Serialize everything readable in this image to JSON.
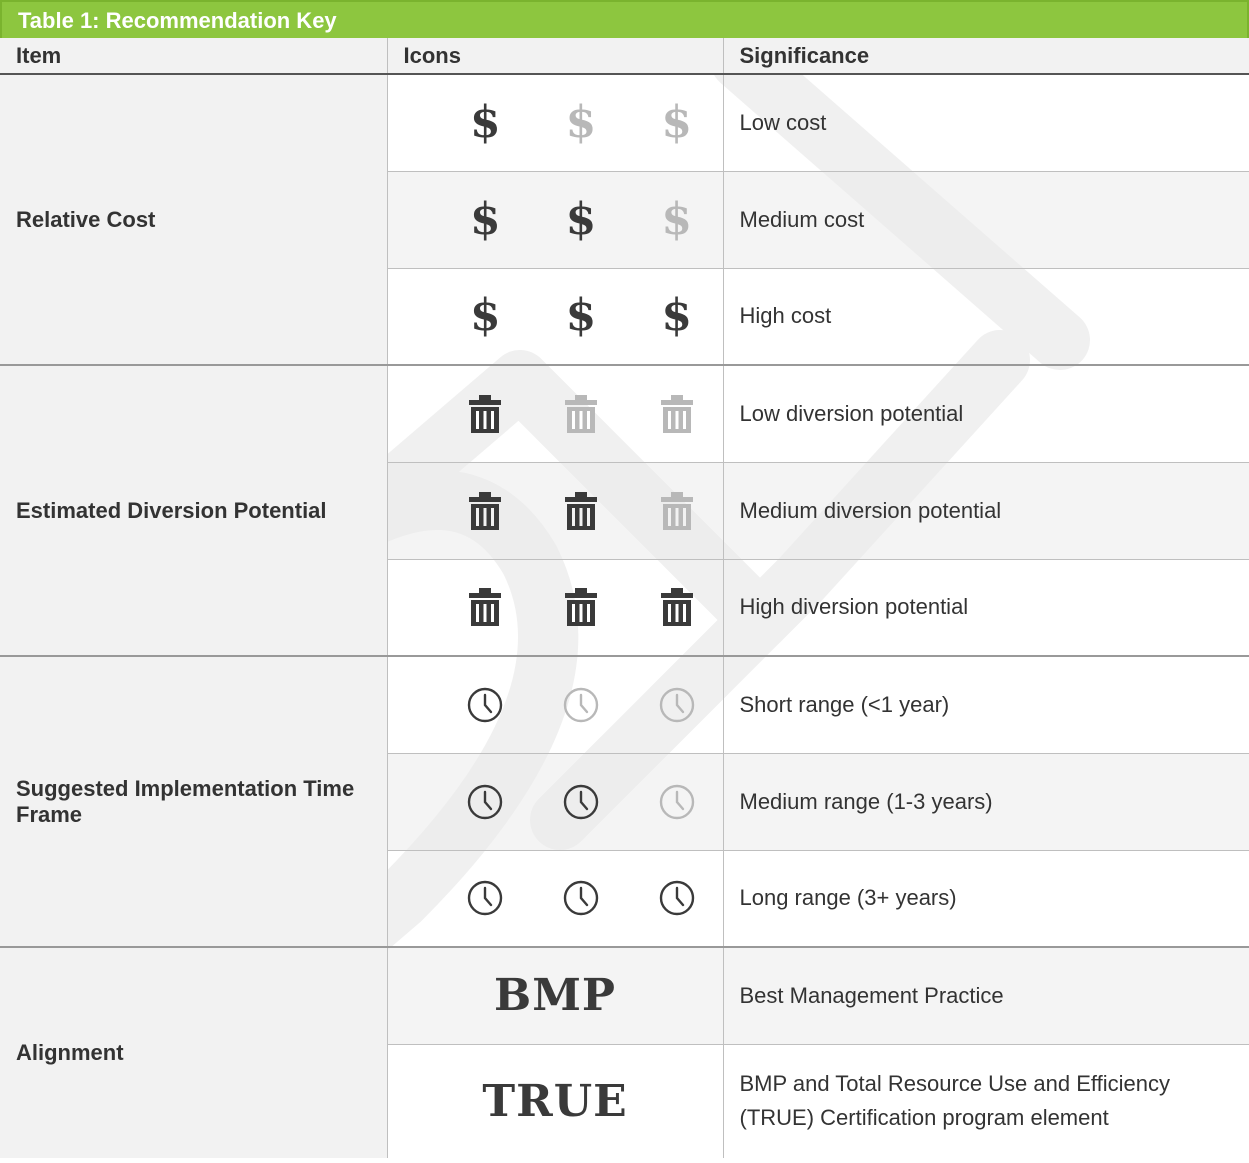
{
  "table": {
    "title": "Table 1: Recommendation Key",
    "headers": {
      "item": "Item",
      "icons": "Icons",
      "significance": "Significance"
    },
    "icon_symbols": {
      "dollar": "$"
    },
    "groups": {
      "cost": {
        "item": "Relative Cost",
        "icon": "dollar-icon",
        "rows": [
          {
            "level": 1,
            "significance": "Low cost"
          },
          {
            "level": 2,
            "significance": "Medium cost"
          },
          {
            "level": 3,
            "significance": "High cost"
          }
        ]
      },
      "diversion": {
        "item": "Estimated Diversion Potential",
        "icon": "trash-can-icon",
        "rows": [
          {
            "level": 1,
            "significance": "Low diversion potential"
          },
          {
            "level": 2,
            "significance": "Medium diversion potential"
          },
          {
            "level": 3,
            "significance": "High diversion potential"
          }
        ]
      },
      "timeframe": {
        "item": "Suggested Implementation Time Frame",
        "icon": "clock-icon",
        "rows": [
          {
            "level": 1,
            "significance": "Short range (<1 year)"
          },
          {
            "level": 2,
            "significance": "Medium range (1-3 years)"
          },
          {
            "level": 3,
            "significance": "Long range (3+ years)"
          }
        ]
      },
      "alignment": {
        "item": "Alignment",
        "rows": [
          {
            "badge": "BMP",
            "significance": "Best Management Practice"
          },
          {
            "badge": "TRUE",
            "significance": "BMP and Total Resource Use and Efficiency (TRUE) Certification program element"
          }
        ]
      }
    }
  },
  "colors": {
    "title_bar": "#8dc63f",
    "icon_on": "#3a3a3a",
    "icon_off": "#b8b8b8",
    "header_bg": "#f2f2f2"
  }
}
